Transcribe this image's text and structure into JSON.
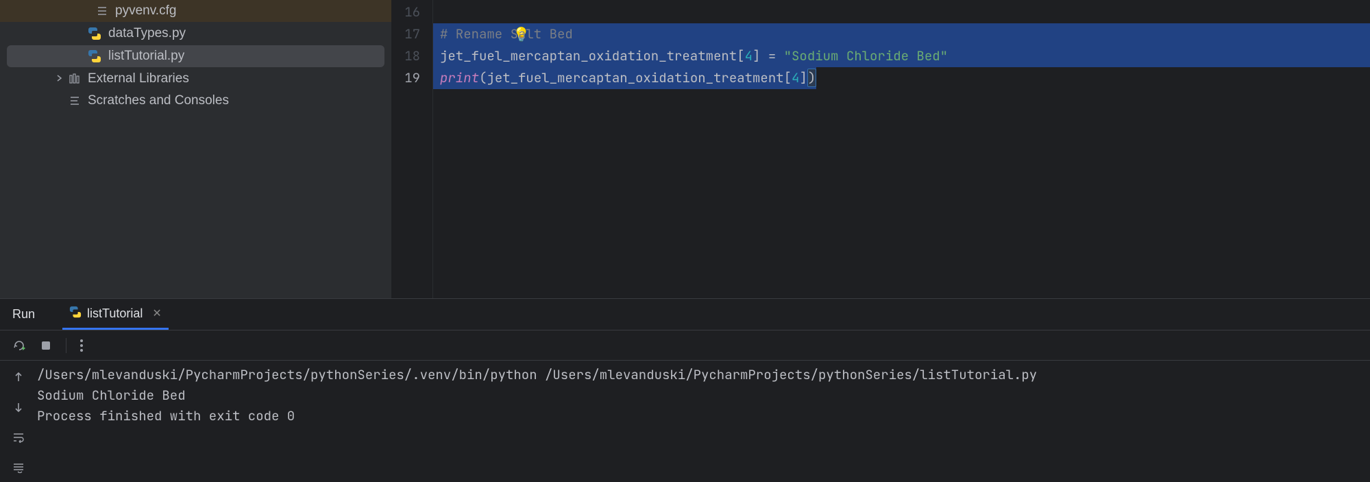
{
  "sidebar": {
    "items": [
      {
        "name": "pyvenv.cfg",
        "icon": "cfg"
      },
      {
        "name": "dataTypes.py",
        "icon": "py"
      },
      {
        "name": "listTutorial.py",
        "icon": "py"
      },
      {
        "name": "External Libraries",
        "icon": "lib"
      },
      {
        "name": "Scratches and Consoles",
        "icon": "scratch"
      }
    ]
  },
  "editor": {
    "lines": [
      {
        "num": "16",
        "type": "bulb"
      },
      {
        "num": "17",
        "type": "comment",
        "text": "# Rename Salt Bed"
      },
      {
        "num": "18",
        "type": "assign",
        "var": "jet_fuel_mercaptan_oxidation_treatment",
        "idx": "4",
        "eq": " = ",
        "str": "\"Sodium Chloride Bed\""
      },
      {
        "num": "19",
        "type": "print",
        "func": "print",
        "var": "jet_fuel_mercaptan_oxidation_treatment",
        "idx": "4"
      }
    ]
  },
  "run": {
    "label": "Run",
    "tab": "listTutorial",
    "console": {
      "cmd": "/Users/mlevanduski/PycharmProjects/pythonSeries/.venv/bin/python /Users/mlevanduski/PycharmProjects/pythonSeries/listTutorial.py",
      "out": "Sodium Chloride Bed",
      "blank": "",
      "exit": "Process finished with exit code 0"
    }
  }
}
